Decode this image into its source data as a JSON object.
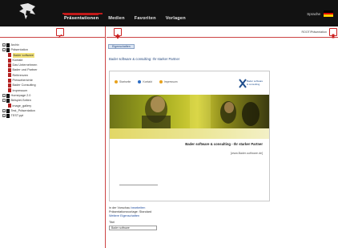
{
  "app": {
    "nav": [
      "Präsentationen",
      "Medien",
      "Favoriten",
      "Vorlagen"
    ],
    "active_nav": 0,
    "language_label": "Sprache",
    "flag_colors": [
      "#000000",
      "#dd0000",
      "#ffcc00"
    ],
    "accent_color": "#c11a1a"
  },
  "left_toolbar": {
    "add_icon": "plus-icon"
  },
  "right_toolbar": {
    "up_icon": "arrow-up-icon",
    "status_text": "ROOT/Präsentation",
    "close_icon": "close-icon"
  },
  "tree": [
    {
      "indent": 0,
      "label": "Archiv",
      "type": "folder",
      "expander": "+"
    },
    {
      "indent": 0,
      "label": "Präsentation",
      "type": "folder",
      "expander": "−"
    },
    {
      "indent": 1,
      "label": "Bader software",
      "type": "page",
      "selected": true
    },
    {
      "indent": 1,
      "label": "Kontakt",
      "type": "page"
    },
    {
      "indent": 1,
      "label": "Das Unternehmen",
      "type": "page"
    },
    {
      "indent": 1,
      "label": "Bader und Partner",
      "type": "page"
    },
    {
      "indent": 1,
      "label": "Referenzen",
      "type": "page"
    },
    {
      "indent": 1,
      "label": "Presseberichte",
      "type": "page"
    },
    {
      "indent": 1,
      "label": "Bader Consulting",
      "type": "page"
    },
    {
      "indent": 1,
      "label": "Impressum",
      "type": "page"
    },
    {
      "indent": 0,
      "label": "Homepage 2.0",
      "type": "folder",
      "expander": "+"
    },
    {
      "indent": 0,
      "label": "Beispiel-Seiten",
      "type": "folder",
      "expander": "−"
    },
    {
      "indent": 1,
      "label": "image_gallery",
      "type": "page"
    },
    {
      "indent": 0,
      "label": "Test_Präsentation",
      "type": "folder",
      "expander": "+"
    },
    {
      "indent": 0,
      "label": "TEST.ppt",
      "type": "folder",
      "expander": "+"
    }
  ],
  "content": {
    "tab_label": "Eigenschaften",
    "title": "Bader software & consulting: Ihr starker Partner",
    "preview": {
      "links": [
        {
          "label": "Startseite",
          "color": "#e8a21c"
        },
        {
          "label": "Kontakt",
          "color": "#2c6cc4"
        },
        {
          "label": "Impressum",
          "color": "#e8a21c"
        }
      ],
      "logo_text": [
        "Bader software",
        "& consulting"
      ],
      "headline": "Bader software & consulting - Ihr starker Partner",
      "sub": "[www.Bader-software.de]"
    },
    "line1_prefix": "in der Vorschau",
    "line1_link": "bearbeiten",
    "line2": "Präsentationsvorlage: Standard",
    "line3_link": "Weitere Eigenschaften",
    "field_label": "Titel",
    "field_value": "Bader software"
  }
}
